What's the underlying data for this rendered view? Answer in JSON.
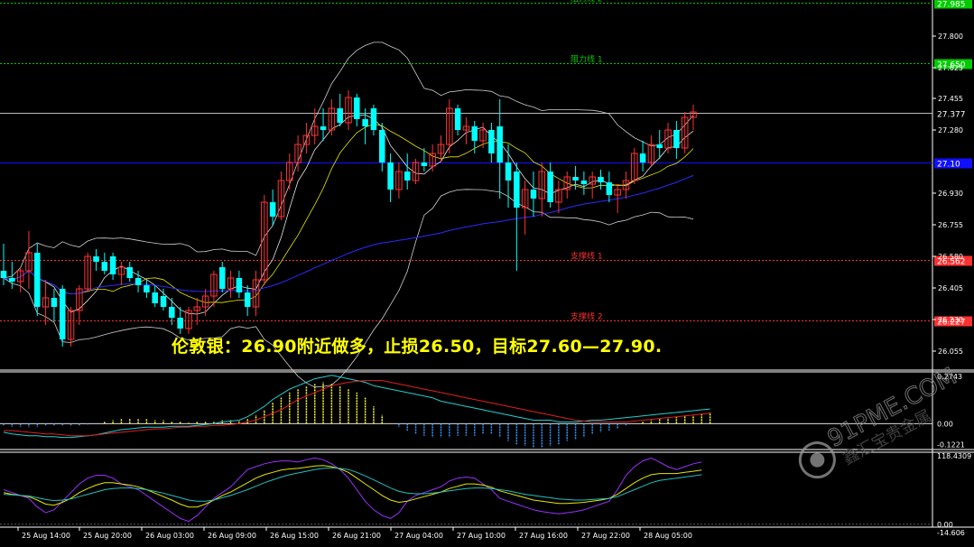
{
  "analysis_text": "伦敦银：26.90附近做多，止损26.50，目标27.60—27.90.",
  "watermark": {
    "site": "91PME.COM",
    "cn": "鑫汇宝贵金属"
  },
  "colors": {
    "bull": "#00ffff",
    "bear": "#ff3333",
    "axis": "#ffffff",
    "resistance": "#00cc00",
    "support": "#ff3030",
    "blue_line": "#1010ff",
    "ma_yellow": "#e6e600",
    "ma_blue": "#2a2aff",
    "band": "#cfcfcf",
    "price_line": "#bbbbbb"
  },
  "chart_data": {
    "type": "candlestick",
    "symbol": "",
    "x_tick_labels": [
      "25 Aug 14:00",
      "25 Aug 20:00",
      "26 Aug 03:00",
      "26 Aug 09:00",
      "26 Aug 15:00",
      "26 Aug 21:00",
      "27 Aug 04:00",
      "27 Aug 10:00",
      "27 Aug 16:00",
      "27 Aug 22:00",
      "28 Aug 05:00"
    ],
    "price_axis_ticks": [
      "27.800",
      "27.625",
      "27.455",
      "27.280",
      "26.930",
      "26.755",
      "26.580",
      "26.405",
      "26.230",
      "26.055"
    ],
    "price_ylim": [
      25.95,
      28.0
    ],
    "levels": [
      {
        "name": "阻力线 2",
        "value": 27.985,
        "label": "27.985",
        "kind": "resistance"
      },
      {
        "name": "阻力线 1",
        "value": 27.65,
        "label": "27.650",
        "kind": "resistance"
      },
      {
        "name": "",
        "value": 27.377,
        "label": "27.377",
        "kind": "current"
      },
      {
        "name": "",
        "value": 27.1,
        "label": "27.10",
        "kind": "blue"
      },
      {
        "name": "支撑线 1",
        "value": 26.562,
        "label": "26.562",
        "kind": "support"
      },
      {
        "name": "支撑线 2",
        "value": 26.227,
        "label": "26.227",
        "kind": "support"
      }
    ],
    "candles": [
      {
        "o": 26.5,
        "h": 26.65,
        "l": 26.42,
        "c": 26.46
      },
      {
        "o": 26.46,
        "h": 26.55,
        "l": 26.4,
        "c": 26.44
      },
      {
        "o": 26.44,
        "h": 26.52,
        "l": 26.38,
        "c": 26.5
      },
      {
        "o": 26.5,
        "h": 26.72,
        "l": 26.4,
        "c": 26.6
      },
      {
        "o": 26.6,
        "h": 26.65,
        "l": 26.25,
        "c": 26.3
      },
      {
        "o": 26.3,
        "h": 26.45,
        "l": 26.2,
        "c": 26.35
      },
      {
        "o": 26.35,
        "h": 26.4,
        "l": 26.22,
        "c": 26.3
      },
      {
        "o": 26.4,
        "h": 26.42,
        "l": 26.08,
        "c": 26.12
      },
      {
        "o": 26.12,
        "h": 26.3,
        "l": 26.08,
        "c": 26.28
      },
      {
        "o": 26.28,
        "h": 26.42,
        "l": 26.2,
        "c": 26.4
      },
      {
        "o": 26.4,
        "h": 26.6,
        "l": 26.38,
        "c": 26.58
      },
      {
        "o": 26.58,
        "h": 26.62,
        "l": 26.5,
        "c": 26.55
      },
      {
        "o": 26.55,
        "h": 26.6,
        "l": 26.48,
        "c": 26.5
      },
      {
        "o": 26.58,
        "h": 26.6,
        "l": 26.45,
        "c": 26.48
      },
      {
        "o": 26.48,
        "h": 26.55,
        "l": 26.42,
        "c": 26.52
      },
      {
        "o": 26.52,
        "h": 26.55,
        "l": 26.44,
        "c": 26.46
      },
      {
        "o": 26.46,
        "h": 26.5,
        "l": 26.38,
        "c": 26.42
      },
      {
        "o": 26.42,
        "h": 26.45,
        "l": 26.35,
        "c": 26.38
      },
      {
        "o": 26.38,
        "h": 26.42,
        "l": 26.3,
        "c": 26.32
      },
      {
        "o": 26.36,
        "h": 26.4,
        "l": 26.28,
        "c": 26.3
      },
      {
        "o": 26.3,
        "h": 26.35,
        "l": 26.2,
        "c": 26.24
      },
      {
        "o": 26.24,
        "h": 26.3,
        "l": 26.15,
        "c": 26.18
      },
      {
        "o": 26.18,
        "h": 26.3,
        "l": 26.15,
        "c": 26.28
      },
      {
        "o": 26.28,
        "h": 26.35,
        "l": 26.2,
        "c": 26.3
      },
      {
        "o": 26.3,
        "h": 26.4,
        "l": 26.25,
        "c": 26.36
      },
      {
        "o": 26.36,
        "h": 26.5,
        "l": 26.3,
        "c": 26.48
      },
      {
        "o": 26.52,
        "h": 26.55,
        "l": 26.38,
        "c": 26.4
      },
      {
        "o": 26.4,
        "h": 26.5,
        "l": 26.35,
        "c": 26.46
      },
      {
        "o": 26.46,
        "h": 26.5,
        "l": 26.35,
        "c": 26.38
      },
      {
        "o": 26.38,
        "h": 26.42,
        "l": 26.25,
        "c": 26.3
      },
      {
        "o": 26.3,
        "h": 26.5,
        "l": 26.25,
        "c": 26.45
      },
      {
        "o": 26.45,
        "h": 26.92,
        "l": 26.42,
        "c": 26.88
      },
      {
        "o": 26.88,
        "h": 26.95,
        "l": 26.75,
        "c": 26.8
      },
      {
        "o": 26.8,
        "h": 27.05,
        "l": 26.78,
        "c": 27.0
      },
      {
        "o": 27.0,
        "h": 27.15,
        "l": 26.95,
        "c": 27.1
      },
      {
        "o": 27.1,
        "h": 27.25,
        "l": 27.05,
        "c": 27.2
      },
      {
        "o": 27.2,
        "h": 27.32,
        "l": 27.15,
        "c": 27.25
      },
      {
        "o": 27.25,
        "h": 27.4,
        "l": 27.2,
        "c": 27.3
      },
      {
        "o": 27.3,
        "h": 27.4,
        "l": 27.22,
        "c": 27.28
      },
      {
        "o": 27.28,
        "h": 27.45,
        "l": 27.25,
        "c": 27.4
      },
      {
        "o": 27.4,
        "h": 27.48,
        "l": 27.3,
        "c": 27.32
      },
      {
        "o": 27.32,
        "h": 27.5,
        "l": 27.28,
        "c": 27.46
      },
      {
        "o": 27.46,
        "h": 27.48,
        "l": 27.3,
        "c": 27.34
      },
      {
        "o": 27.34,
        "h": 27.4,
        "l": 27.2,
        "c": 27.3
      },
      {
        "o": 27.4,
        "h": 27.42,
        "l": 27.25,
        "c": 27.28
      },
      {
        "o": 27.28,
        "h": 27.32,
        "l": 27.05,
        "c": 27.1
      },
      {
        "o": 27.1,
        "h": 27.15,
        "l": 26.88,
        "c": 26.95
      },
      {
        "o": 26.95,
        "h": 27.1,
        "l": 26.9,
        "c": 27.05
      },
      {
        "o": 27.05,
        "h": 27.15,
        "l": 26.95,
        "c": 27.0
      },
      {
        "o": 27.0,
        "h": 27.12,
        "l": 26.98,
        "c": 27.1
      },
      {
        "o": 27.1,
        "h": 27.18,
        "l": 27.05,
        "c": 27.08
      },
      {
        "o": 27.08,
        "h": 27.2,
        "l": 27.05,
        "c": 27.15
      },
      {
        "o": 27.15,
        "h": 27.25,
        "l": 27.1,
        "c": 27.2
      },
      {
        "o": 27.2,
        "h": 27.45,
        "l": 27.15,
        "c": 27.4
      },
      {
        "o": 27.4,
        "h": 27.42,
        "l": 27.25,
        "c": 27.28
      },
      {
        "o": 27.28,
        "h": 27.35,
        "l": 27.2,
        "c": 27.3
      },
      {
        "o": 27.3,
        "h": 27.33,
        "l": 27.15,
        "c": 27.22
      },
      {
        "o": 27.22,
        "h": 27.32,
        "l": 27.18,
        "c": 27.28
      },
      {
        "o": 27.28,
        "h": 27.32,
        "l": 27.1,
        "c": 27.15
      },
      {
        "o": 27.3,
        "h": 27.45,
        "l": 26.9,
        "c": 27.1
      },
      {
        "o": 27.1,
        "h": 27.2,
        "l": 26.85,
        "c": 27.0
      },
      {
        "o": 27.05,
        "h": 27.1,
        "l": 26.5,
        "c": 26.85
      },
      {
        "o": 26.85,
        "h": 27.0,
        "l": 26.7,
        "c": 26.95
      },
      {
        "o": 26.95,
        "h": 27.05,
        "l": 26.8,
        "c": 26.9
      },
      {
        "o": 26.9,
        "h": 27.1,
        "l": 26.8,
        "c": 27.05
      },
      {
        "o": 27.05,
        "h": 27.1,
        "l": 26.85,
        "c": 26.88
      },
      {
        "o": 26.88,
        "h": 27.0,
        "l": 26.82,
        "c": 26.95
      },
      {
        "o": 26.95,
        "h": 27.05,
        "l": 26.9,
        "c": 27.02
      },
      {
        "o": 27.02,
        "h": 27.08,
        "l": 26.95,
        "c": 27.0
      },
      {
        "o": 27.0,
        "h": 27.05,
        "l": 26.92,
        "c": 26.98
      },
      {
        "o": 26.98,
        "h": 27.05,
        "l": 26.9,
        "c": 27.02
      },
      {
        "o": 27.02,
        "h": 27.06,
        "l": 26.95,
        "c": 26.99
      },
      {
        "o": 26.99,
        "h": 27.05,
        "l": 26.88,
        "c": 26.92
      },
      {
        "o": 26.92,
        "h": 26.98,
        "l": 26.82,
        "c": 26.95
      },
      {
        "o": 26.95,
        "h": 27.05,
        "l": 26.9,
        "c": 27.0
      },
      {
        "o": 27.0,
        "h": 27.18,
        "l": 26.98,
        "c": 27.15
      },
      {
        "o": 27.15,
        "h": 27.22,
        "l": 27.05,
        "c": 27.1
      },
      {
        "o": 27.1,
        "h": 27.25,
        "l": 27.08,
        "c": 27.2
      },
      {
        "o": 27.2,
        "h": 27.28,
        "l": 27.12,
        "c": 27.18
      },
      {
        "o": 27.18,
        "h": 27.32,
        "l": 27.15,
        "c": 27.28
      },
      {
        "o": 27.28,
        "h": 27.33,
        "l": 27.12,
        "c": 27.18
      },
      {
        "o": 27.18,
        "h": 27.38,
        "l": 27.15,
        "c": 27.35
      },
      {
        "o": 27.35,
        "h": 27.42,
        "l": 27.28,
        "c": 27.38
      }
    ],
    "macd": {
      "ylim": [
        -0.15,
        0.3
      ],
      "tick_labels": [
        "0.2743",
        "0.00",
        "-0.1221"
      ],
      "hist": [
        -0.01,
        -0.02,
        -0.02,
        -0.02,
        -0.02,
        -0.01,
        -0.01,
        -0.01,
        -0.01,
        -0.01,
        -0.005,
        0.0,
        0.01,
        0.02,
        0.03,
        0.03,
        0.03,
        0.03,
        0.02,
        0.02,
        0.01,
        0.01,
        0.005,
        0.01,
        0.01,
        0.01,
        0.02,
        0.02,
        0.02,
        0.03,
        0.05,
        0.08,
        0.12,
        0.15,
        0.18,
        0.2,
        0.22,
        0.23,
        0.24,
        0.23,
        0.22,
        0.2,
        0.18,
        0.15,
        0.1,
        0.05,
        0.0,
        -0.02,
        -0.04,
        -0.06,
        -0.07,
        -0.08,
        -0.08,
        -0.08,
        -0.07,
        -0.07,
        -0.07,
        -0.06,
        -0.06,
        -0.08,
        -0.1,
        -0.12,
        -0.13,
        -0.14,
        -0.14,
        -0.13,
        -0.12,
        -0.1,
        -0.09,
        -0.08,
        -0.06,
        -0.05,
        -0.04,
        -0.03,
        -0.01,
        0.0,
        0.01,
        0.02,
        0.03,
        0.035,
        0.04,
        0.045,
        0.05,
        0.06,
        0.065
      ],
      "signal": [
        -0.04,
        -0.04,
        -0.045,
        -0.05,
        -0.055,
        -0.06,
        -0.06,
        -0.065,
        -0.07,
        -0.07,
        -0.07,
        -0.065,
        -0.06,
        -0.055,
        -0.05,
        -0.045,
        -0.04,
        -0.035,
        -0.03,
        -0.03,
        -0.025,
        -0.02,
        -0.02,
        -0.015,
        -0.015,
        -0.01,
        -0.01,
        -0.005,
        0.0,
        0.01,
        0.02,
        0.04,
        0.06,
        0.08,
        0.11,
        0.14,
        0.16,
        0.18,
        0.2,
        0.22,
        0.23,
        0.24,
        0.245,
        0.25,
        0.25,
        0.25,
        0.24,
        0.23,
        0.22,
        0.21,
        0.2,
        0.19,
        0.18,
        0.17,
        0.16,
        0.15,
        0.14,
        0.13,
        0.12,
        0.11,
        0.1,
        0.09,
        0.08,
        0.07,
        0.06,
        0.05,
        0.04,
        0.03,
        0.02,
        0.015,
        0.01,
        0.01,
        0.01,
        0.01,
        0.01,
        0.015,
        0.02,
        0.025,
        0.03,
        0.035,
        0.04,
        0.045,
        0.05,
        0.055,
        0.06
      ],
      "dif": [
        -0.05,
        -0.06,
        -0.065,
        -0.07,
        -0.07,
        -0.075,
        -0.075,
        -0.08,
        -0.08,
        -0.075,
        -0.07,
        -0.065,
        -0.055,
        -0.045,
        -0.035,
        -0.03,
        -0.025,
        -0.02,
        -0.02,
        -0.02,
        -0.015,
        -0.015,
        -0.015,
        -0.01,
        -0.005,
        0.0,
        0.01,
        0.015,
        0.02,
        0.04,
        0.07,
        0.1,
        0.14,
        0.17,
        0.2,
        0.22,
        0.24,
        0.26,
        0.27,
        0.28,
        0.27,
        0.26,
        0.25,
        0.24,
        0.22,
        0.21,
        0.2,
        0.19,
        0.18,
        0.17,
        0.16,
        0.15,
        0.13,
        0.12,
        0.11,
        0.1,
        0.09,
        0.08,
        0.07,
        0.06,
        0.05,
        0.04,
        0.03,
        0.02,
        0.02,
        0.02,
        0.01,
        0.01,
        0.01,
        0.015,
        0.02,
        0.02,
        0.025,
        0.03,
        0.035,
        0.04,
        0.045,
        0.05,
        0.055,
        0.06,
        0.065,
        0.07,
        0.075,
        0.08,
        0.085
      ]
    },
    "osc": {
      "ylim": [
        -5,
        125
      ],
      "tick_labels": [
        "118.4309",
        "0.00",
        "-14.606"
      ],
      "purple": [
        60,
        55,
        50,
        45,
        30,
        20,
        25,
        40,
        55,
        70,
        80,
        85,
        85,
        80,
        70,
        65,
        60,
        50,
        40,
        30,
        20,
        10,
        5,
        15,
        30,
        45,
        55,
        65,
        80,
        95,
        100,
        105,
        108,
        110,
        110,
        108,
        112,
        115,
        112,
        105,
        95,
        80,
        60,
        40,
        25,
        15,
        10,
        20,
        40,
        50,
        55,
        60,
        65,
        75,
        80,
        82,
        80,
        70,
        60,
        45,
        40,
        35,
        30,
        25,
        22,
        20,
        18,
        20,
        22,
        25,
        30,
        35,
        40,
        60,
        85,
        100,
        110,
        115,
        108,
        100,
        95,
        100,
        105,
        108
      ],
      "yellow": [
        55,
        52,
        50,
        48,
        42,
        35,
        33,
        38,
        45,
        55,
        62,
        68,
        72,
        72,
        70,
        68,
        65,
        60,
        54,
        48,
        42,
        35,
        30,
        30,
        35,
        42,
        50,
        56,
        64,
        72,
        80,
        86,
        90,
        94,
        96,
        97,
        99,
        101,
        102,
        100,
        96,
        90,
        80,
        70,
        60,
        50,
        42,
        38,
        40,
        44,
        48,
        52,
        56,
        62,
        66,
        70,
        70,
        68,
        64,
        58,
        54,
        50,
        46,
        42,
        40,
        38,
        36,
        36,
        37,
        38,
        40,
        42,
        45,
        52,
        62,
        72,
        80,
        86,
        88,
        88,
        88,
        90,
        92,
        94
      ],
      "cyan": [
        52,
        51,
        50,
        49,
        46,
        43,
        41,
        42,
        44,
        48,
        52,
        56,
        60,
        62,
        63,
        63,
        62,
        60,
        57,
        54,
        50,
        46,
        42,
        40,
        40,
        42,
        46,
        50,
        55,
        60,
        66,
        72,
        77,
        82,
        86,
        89,
        92,
        95,
        97,
        98,
        97,
        95,
        90,
        84,
        77,
        70,
        63,
        57,
        54,
        53,
        53,
        54,
        56,
        58,
        60,
        62,
        63,
        63,
        62,
        60,
        58,
        55,
        52,
        50,
        48,
        46,
        44,
        43,
        42,
        42,
        43,
        44,
        45,
        48,
        54,
        60,
        66,
        72,
        76,
        78,
        80,
        82,
        84,
        86
      ]
    }
  },
  "labels": {
    "res2": "阻力线 2",
    "res1": "阻力线 1",
    "sup1": "支撑线 1",
    "sup2": "支撑线 2",
    "lvl_res2": "27.985",
    "lvl_res1": "27.650",
    "lvl_cur": "27.377",
    "lvl_blue": "27.10",
    "lvl_sup1": "26.562",
    "lvl_sup2": "26.227",
    "macd_ind": "0.00"
  }
}
